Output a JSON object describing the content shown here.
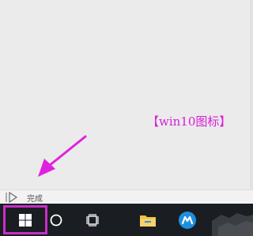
{
  "annotation": {
    "text": "【win10图标】",
    "color": "#d61fd6"
  },
  "statusbar": {
    "icon": "play-icon",
    "text": "完成"
  },
  "taskbar": {
    "background": "#1a1d21",
    "highlight_color": "#c92ec9",
    "items": [
      {
        "name": "start-button",
        "icon": "windows-logo-icon",
        "highlighted": true
      },
      {
        "name": "search-button",
        "icon": "circle-search-icon"
      },
      {
        "name": "task-view-button",
        "icon": "task-view-icon"
      },
      {
        "name": "file-explorer-button",
        "icon": "folder-icon"
      },
      {
        "name": "app-button",
        "icon": "app-logo-icon"
      }
    ]
  }
}
